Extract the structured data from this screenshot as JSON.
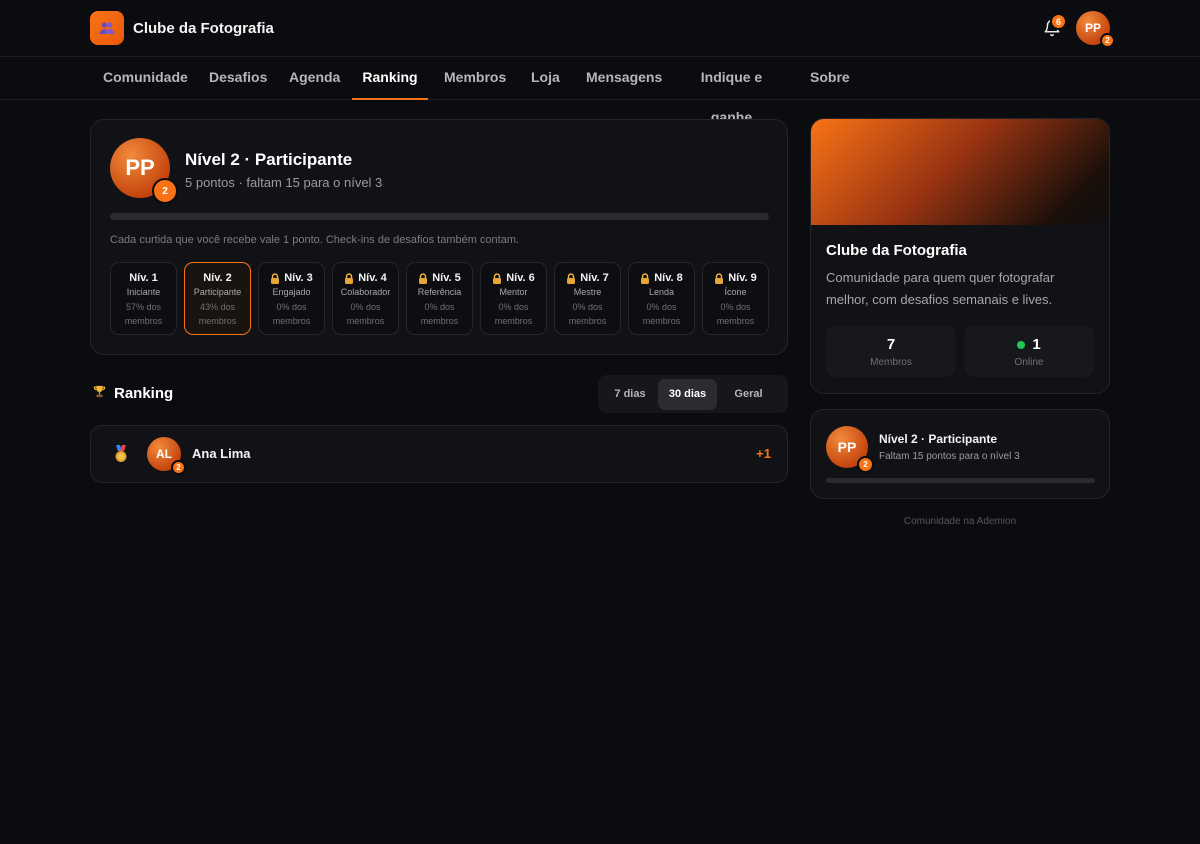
{
  "header": {
    "brand": "Clube da Fotografia",
    "notifications_count": "6",
    "user_initials": "PP",
    "user_level": "2"
  },
  "nav": {
    "items": [
      "Comunidade",
      "Desafios",
      "Agenda",
      "Ranking",
      "Membros",
      "Loja",
      "Mensagens",
      "Indique e ganhe",
      "Sobre"
    ],
    "active": "Ranking"
  },
  "level_card": {
    "initials": "PP",
    "level_badge": "2",
    "title": "Nível 2 · Participante",
    "subtitle": "5 pontos · faltam 15 para o nível 3",
    "progress": 0,
    "hint": "Cada curtida que você recebe vale 1 ponto. Check-ins de desafios também contam.",
    "levels": [
      {
        "name": "Nív. 1",
        "label": "Iniciante",
        "pct": "57% dos membros",
        "locked": false,
        "current": false
      },
      {
        "name": "Nív. 2",
        "label": "Participante",
        "pct": "43% dos membros",
        "locked": false,
        "current": true
      },
      {
        "name": "Nív. 3",
        "label": "Engajado",
        "pct": "0% dos membros",
        "locked": true,
        "current": false
      },
      {
        "name": "Nív. 4",
        "label": "Colaborador",
        "pct": "0% dos membros",
        "locked": true,
        "current": false
      },
      {
        "name": "Nív. 5",
        "label": "Referência",
        "pct": "0% dos membros",
        "locked": true,
        "current": false
      },
      {
        "name": "Nív. 6",
        "label": "Mentor",
        "pct": "0% dos membros",
        "locked": true,
        "current": false
      },
      {
        "name": "Nív. 7",
        "label": "Mestre",
        "pct": "0% dos membros",
        "locked": true,
        "current": false
      },
      {
        "name": "Nív. 8",
        "label": "Lenda",
        "pct": "0% dos membros",
        "locked": true,
        "current": false
      },
      {
        "name": "Nív. 9",
        "label": "Ícone",
        "pct": "0% dos membros",
        "locked": true,
        "current": false
      }
    ]
  },
  "ranking": {
    "title": "Ranking",
    "tabs": [
      "7 dias",
      "30 dias",
      "Geral"
    ],
    "active_tab": "30 dias",
    "rows": [
      {
        "initials": "AL",
        "level": "2",
        "name": "Ana Lima",
        "points": "+1"
      }
    ]
  },
  "club": {
    "name": "Clube da Fotografia",
    "description": "Comunidade para quem quer fotografar melhor, com desafios semanais e lives.",
    "members_value": "7",
    "members_label": "Membros",
    "online_value": "1",
    "online_label": "Online"
  },
  "mini_level": {
    "initials": "PP",
    "level_badge": "2",
    "title": "Nível 2 · Participante",
    "subtitle": "Faltam 15 pontos para o nível 3",
    "progress": 0
  },
  "footer": "Comunidade na Ademion",
  "colors": {
    "accent": "#f97316",
    "online": "#22c55e",
    "background": "#0b0c0f"
  }
}
